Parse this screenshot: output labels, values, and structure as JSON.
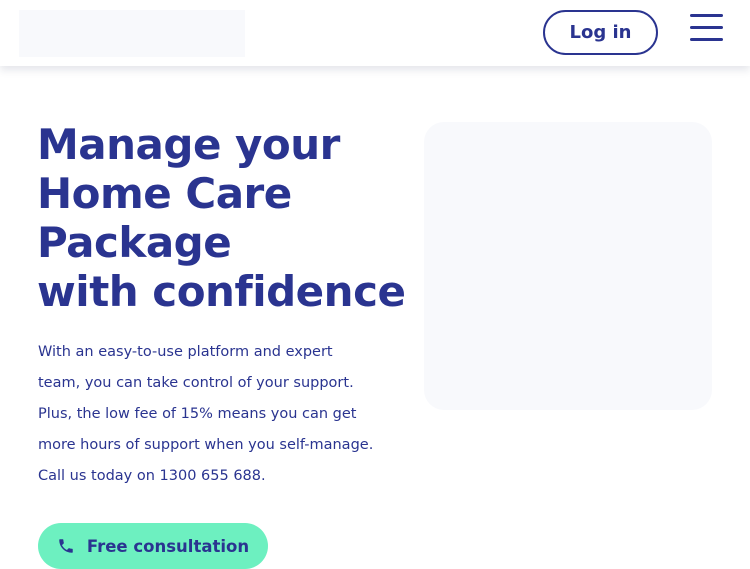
{
  "header": {
    "login_label": "Log in"
  },
  "hero": {
    "title_lines": [
      "Manage your",
      "Home Care",
      "Package",
      "with confidence"
    ],
    "body_lines": [
      "With an easy-to-use platform and expert",
      "team, you can take control of your support.",
      "Plus, the low fee of 15% means you can get",
      "more hours of support when you self-manage.",
      "Call us today on 1300 655 688."
    ],
    "cta": {
      "label": "Free consultation",
      "icon": "phone-icon"
    }
  },
  "colors": {
    "brand_navy": "#2a3490",
    "cta_mint": "#6df0c0",
    "placeholder_gray": "#f8f9fc"
  }
}
